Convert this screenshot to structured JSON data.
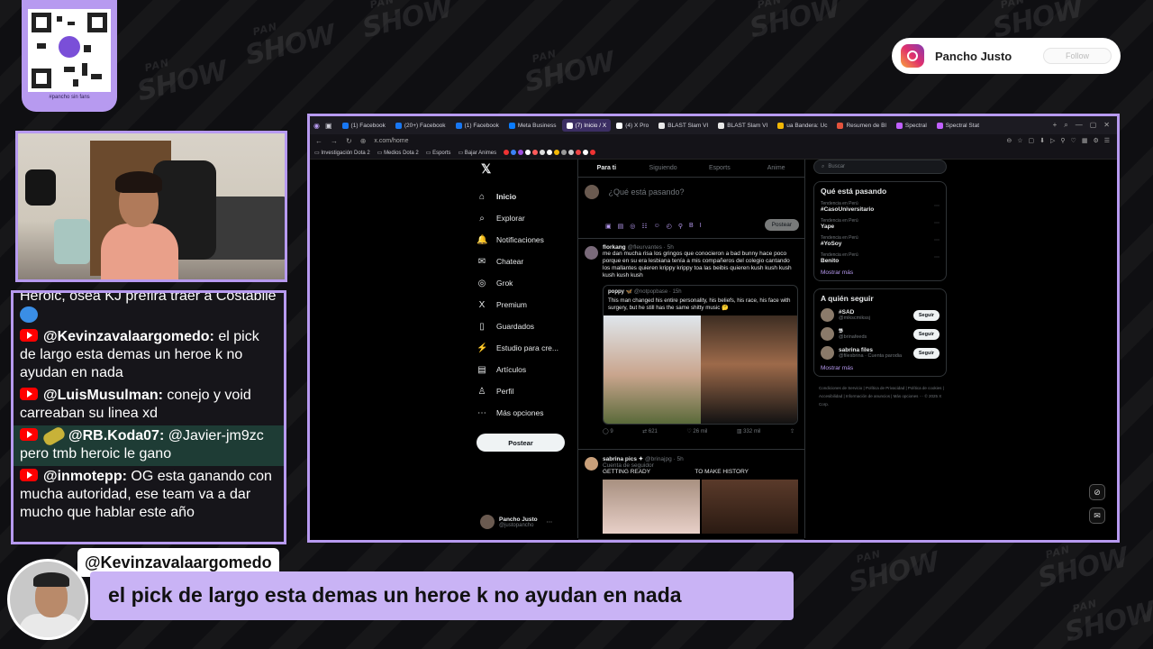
{
  "qr": {
    "caption": "#pancho sin fans"
  },
  "follow_card": {
    "name": "Pancho Justo",
    "button": "Follow"
  },
  "watermark": {
    "top": "PAN",
    "bottom": "SHOW"
  },
  "chat": [
    {
      "user": "",
      "text": "Heroic, osea KJ prefira traer a Costabile",
      "cut": true
    },
    {
      "user": "@Kevinzavalaargomedo:",
      "text": " el pick de largo esta demas un heroe k no ayudan en nada"
    },
    {
      "user": "@LuisMusulman:",
      "text": " conejo y void carreaban su linea xd"
    },
    {
      "user": "@RB.Koda07:",
      "text": " @Javier-jm9zc pero tmb heroic le gano",
      "highlight": true
    },
    {
      "user": "@inmotepp:",
      "text": " OG esta ganando con mucha autoridad, ese team va a dar mucho que hablar este año"
    }
  ],
  "browser": {
    "tabs": [
      {
        "label": "(1) Facebook",
        "color": "#1877f2"
      },
      {
        "label": "(20+) Facebook",
        "color": "#1877f2"
      },
      {
        "label": "(1) Facebook",
        "color": "#1877f2"
      },
      {
        "label": "Meta Business",
        "color": "#0a7cff"
      },
      {
        "label": "(7) Inicio / X",
        "color": "#ffffff",
        "active": true
      },
      {
        "label": "(4) X Pro",
        "color": "#ffffff"
      },
      {
        "label": "BLAST Slam VI",
        "color": "#e8e8e8"
      },
      {
        "label": "BLAST Slam VI",
        "color": "#e8e8e8"
      },
      {
        "label": "ua Bandera: Uc",
        "color": "#f2b705"
      },
      {
        "label": "Resumen de Bl",
        "color": "#e5533d"
      },
      {
        "label": "Spectral",
        "color": "#c060ff"
      },
      {
        "label": "Spectral Stat",
        "color": "#c060ff"
      }
    ],
    "url": "x.com/home",
    "bookmarks": [
      "Investigación Dota 2",
      "Medios Dota 2",
      "Esports",
      "Bajar Animes"
    ]
  },
  "x": {
    "nav": [
      {
        "icon": "⌂",
        "label": "Inicio",
        "bold": true,
        "name": "home"
      },
      {
        "icon": "⌕",
        "label": "Explorar",
        "name": "explore"
      },
      {
        "icon": "🔔",
        "label": "Notificaciones",
        "name": "notifications"
      },
      {
        "icon": "✉",
        "label": "Chatear",
        "name": "chat"
      },
      {
        "icon": "◎",
        "label": "Grok",
        "name": "grok"
      },
      {
        "icon": "X",
        "label": "Premium",
        "name": "premium"
      },
      {
        "icon": "▯",
        "label": "Guardados",
        "name": "bookmarks"
      },
      {
        "icon": "⚡",
        "label": "Estudio para cre...",
        "name": "creator-studio"
      },
      {
        "icon": "▤",
        "label": "Artículos",
        "name": "articles"
      },
      {
        "icon": "♙",
        "label": "Perfil",
        "name": "profile"
      },
      {
        "icon": "⋯",
        "label": "Más opciones",
        "name": "more"
      }
    ],
    "post_button": "Postear",
    "profile": {
      "name": "Pancho Justo",
      "handle": "@justopancho"
    },
    "timeline_tabs": [
      "Para ti",
      "Siguiendo",
      "Esports",
      "Anime"
    ],
    "composer_placeholder": "¿Qué está pasando?",
    "composer_button": "Postear",
    "tweet1": {
      "name": "florkang",
      "handle": "@fleurvantes · 5h",
      "text": "me dan mucha risa los gringos que conocieron a bad bunny hace poco porque en su era lesbiana tenía a mis compañeros del colegio cantando los mallantes quieren krippy krippy toa las beibis quieren kush kush kush kush kush kush",
      "quote_name": "poppy 🦋",
      "quote_handle": "@notpopbase · 15h",
      "quote_text": "This man changed his entire personality, his beliefs, his race, his face with surgery, but he still has the same shitty music 🤔",
      "stats": [
        "9",
        "621",
        "26 mil",
        "332 mil"
      ]
    },
    "tweet2": {
      "name": "sabrina pics ✦",
      "handle": "@brinajpg · 5h",
      "sub": "Cuenta de seguidor",
      "caption_left": "GETTING READY",
      "caption_right": "TO MAKE HISTORY"
    },
    "search_placeholder": "Buscar",
    "trends_title": "Qué está pasando",
    "trends": [
      {
        "meta": "Tendencia en Perú",
        "name": "#CasoUniversitario"
      },
      {
        "meta": "Tendencia en Perú",
        "name": "Yape"
      },
      {
        "meta": "Tendencia en Perú",
        "name": "#YoSoy"
      },
      {
        "meta": "Tendencia en Perú",
        "name": "Benito"
      }
    ],
    "show_more": "Mostrar más",
    "who_title": "A quién seguir",
    "who": [
      {
        "name": "#SAD",
        "handle": "@mikscmikssj",
        "btn": "Seguir"
      },
      {
        "name": "𝕭",
        "handle": "@brinafeeds",
        "btn": "Seguir"
      },
      {
        "name": "sabrina files",
        "handle": "@filesbrina · Cuenta parodia",
        "btn": "Seguir"
      }
    ],
    "show_more2": "Mostrar más",
    "footer": "Condiciones de Servicio | Política de Privacidad | Política de cookies | Accesibilidad | Información de anuncios | Más opciones ··· © 2025 X Corp."
  },
  "lower_third": {
    "user": "@Kevinzavalaargomedo",
    "message": "el pick de largo esta demas un heroe k no ayudan en nada"
  }
}
